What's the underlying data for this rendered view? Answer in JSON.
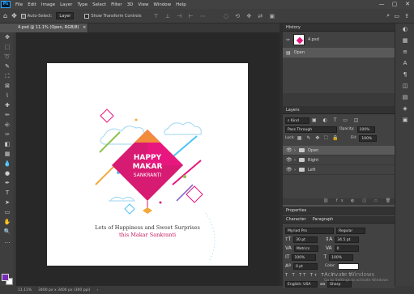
{
  "app": {
    "logo": "Ps"
  },
  "menu": [
    "File",
    "Edit",
    "Image",
    "Layer",
    "Type",
    "Select",
    "Filter",
    "3D",
    "View",
    "Window",
    "Help"
  ],
  "window_controls": [
    "—",
    "▢",
    "✕"
  ],
  "options": {
    "auto_select_label": "Auto-Select:",
    "layer_dropdown": "Layer",
    "transform_label": "Show Transform Controls"
  },
  "document_tab": {
    "label": "4.psd @ 11.1% (Open, RGB/8)",
    "close": "×"
  },
  "canvas": {
    "kite_line1": "HAPPY",
    "kite_line2": "MAKAR",
    "kite_line3": "SANKRANTI",
    "caption_line1": "Lots of Happiness and Sweet Surprises",
    "caption_line2": "this Makar Sankranti",
    "accent_color": "#e8177f",
    "caption_accent": "#c2185b"
  },
  "status": {
    "zoom": "11.11%",
    "doc_info": "3400 px x 3400 px (300 ppi)",
    "arrow": "›"
  },
  "history": {
    "title": "History",
    "snapshot": "4.psd",
    "items": [
      {
        "label": "Open"
      }
    ]
  },
  "layers": {
    "title": "Layers",
    "kind_filter": "Kind",
    "blend_mode": "Pass Through",
    "opacity_label": "Opacity:",
    "opacity": "100%",
    "lock_label": "Lock:",
    "fill_label": "Fill:",
    "fill": "100%",
    "items": [
      {
        "name": "Open"
      },
      {
        "name": "Right"
      },
      {
        "name": "Left"
      }
    ]
  },
  "properties": {
    "title": "Properties"
  },
  "character": {
    "tab_character": "Character",
    "tab_paragraph": "Paragraph",
    "font": "Myriad Pro",
    "style": "Regular",
    "size": "30 pt",
    "leading": "34.5 pt",
    "kerning": "Metrics",
    "tracking": "0",
    "vscale": "100%",
    "hscale": "100%",
    "baseline": "0 pt",
    "color_label": "Color:",
    "lang": "English: USA",
    "aa": "Sharp"
  },
  "watermark": {
    "line1": "Activate Windows",
    "line2": "Go to Settings to activate Windows"
  },
  "toolbar_icons": [
    "move-icon",
    "marquee-icon",
    "lasso-icon",
    "quick-select-icon",
    "crop-icon",
    "frame-icon",
    "eyedropper-icon",
    "healing-icon",
    "brush-icon",
    "stamp-icon",
    "history-brush-icon",
    "eraser-icon",
    "gradient-icon",
    "blur-icon",
    "dodge-icon",
    "pen-icon",
    "type-icon",
    "path-select-icon",
    "shape-icon",
    "hand-icon",
    "zoom-icon",
    "more-icon"
  ],
  "toolbar_glyphs": [
    "✥",
    "⬚",
    "➰",
    "✎",
    "⛶",
    "⊠",
    "⌇",
    "✚",
    "✏",
    "⎆",
    "✑",
    "◧",
    "▦",
    "💧",
    "●",
    "✒",
    "T",
    "➤",
    "▭",
    "✋",
    "🔍",
    "…"
  ],
  "right_strip_glyphs": [
    "◐",
    "▦",
    "≡",
    "A",
    "¶",
    "◫",
    "▤",
    "◈",
    "▣"
  ],
  "colors": {
    "foreground": "#7a2bb5",
    "background": "#ffffff"
  }
}
